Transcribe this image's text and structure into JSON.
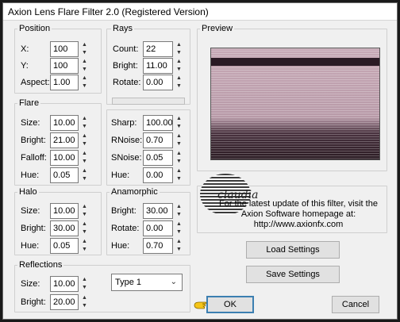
{
  "window": {
    "title": "Axion Lens Flare Filter 2.0 (Registered Version)"
  },
  "position": {
    "title": "Position",
    "fields": [
      {
        "label": "X:",
        "value": "100"
      },
      {
        "label": "Y:",
        "value": "100"
      },
      {
        "label": "Aspect:",
        "value": "1.00"
      }
    ]
  },
  "rays": {
    "title": "Rays",
    "fields": [
      {
        "label": "Count:",
        "value": "22"
      },
      {
        "label": "Bright:",
        "value": "11.00"
      },
      {
        "label": "Rotate:",
        "value": "0.00"
      }
    ]
  },
  "flare": {
    "title": "Flare",
    "fields": [
      {
        "label": "Size:",
        "value": "10.00"
      },
      {
        "label": "Bright:",
        "value": "21.00"
      },
      {
        "label": "Falloff:",
        "value": "10.00"
      },
      {
        "label": "Hue:",
        "value": "0.05"
      }
    ],
    "right_fields": [
      {
        "label": "Sharp:",
        "value": "100.00"
      },
      {
        "label": "RNoise:",
        "value": "0.70"
      },
      {
        "label": "SNoise:",
        "value": "0.05"
      },
      {
        "label": "Hue:",
        "value": "0.00"
      }
    ]
  },
  "halo": {
    "title": "Halo",
    "fields": [
      {
        "label": "Size:",
        "value": "10.00"
      },
      {
        "label": "Bright:",
        "value": "30.00"
      },
      {
        "label": "Hue:",
        "value": "0.05"
      }
    ]
  },
  "anamorphic": {
    "title": "Anamorphic",
    "fields": [
      {
        "label": "Bright:",
        "value": "30.00"
      },
      {
        "label": "Rotate:",
        "value": "0.00"
      },
      {
        "label": "Hue:",
        "value": "0.70"
      }
    ]
  },
  "reflections": {
    "title": "Reflections",
    "fields": [
      {
        "label": "Size:",
        "value": "10.00"
      },
      {
        "label": "Bright:",
        "value": "20.00"
      }
    ],
    "type_select": "Type 1"
  },
  "preview": {
    "title": "Preview",
    "info_line1": "For the latest update of this filter, visit the",
    "info_line2": "Axion Software homepage at:",
    "info_line3": "http://www.axionfx.com",
    "logo_text": "claudia"
  },
  "buttons": {
    "load": "Load Settings",
    "save": "Save Settings",
    "ok": "OK",
    "cancel": "Cancel"
  },
  "colors": {
    "accent": "#3c7fb1"
  }
}
